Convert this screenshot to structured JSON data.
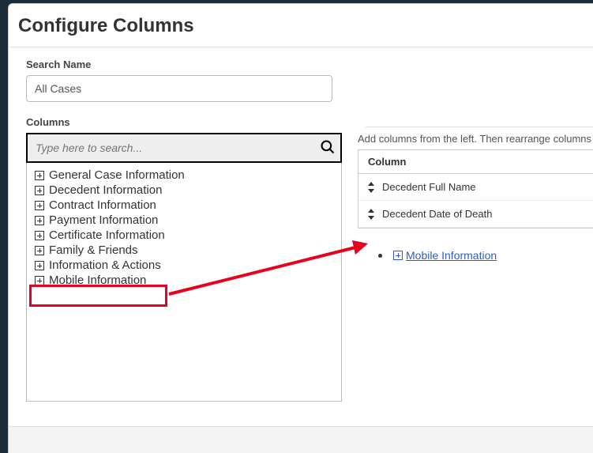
{
  "modal": {
    "title": "Configure Columns",
    "searchNameLabel": "Search Name",
    "searchNameValue": "All Cases",
    "columnsLabel": "Columns",
    "searchPlaceholder": "Type here to search...",
    "treeItems": [
      "General Case Information",
      "Decedent Information",
      "Contract Information",
      "Payment Information",
      "Certificate Information",
      "Family & Friends",
      "Information & Actions",
      "Mobile Information"
    ],
    "rightInstruction": "Add columns from the left. Then rearrange columns fro",
    "columnHeader": "Column",
    "selectedColumns": [
      "Decedent Full Name",
      "Decedent Date of Death"
    ],
    "addLinkLabel": "Mobile Information"
  }
}
